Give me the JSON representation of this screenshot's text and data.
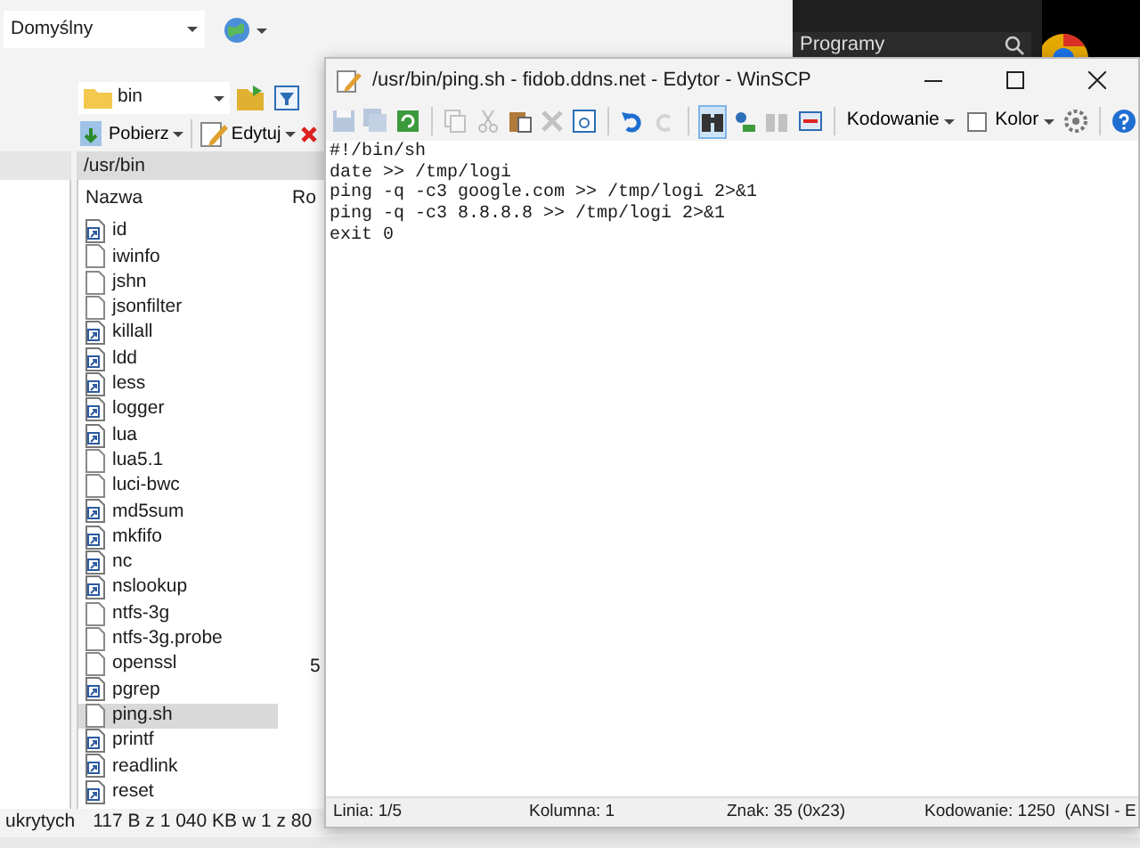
{
  "session": {
    "value": "Domyślny"
  },
  "desktop": {
    "start_search": "Programy"
  },
  "remote_panel": {
    "folder": "bin",
    "actions": [
      {
        "label": "Pobierz",
        "kind": "download"
      },
      {
        "label": "Edytuj",
        "kind": "edit"
      }
    ],
    "path": "/usr/bin",
    "columns": [
      "Nazwa",
      "Ro"
    ],
    "files": [
      {
        "name": "id",
        "kind": "link",
        "selected": false
      },
      {
        "name": "iwinfo",
        "kind": "file",
        "selected": false
      },
      {
        "name": "jshn",
        "kind": "file",
        "selected": false
      },
      {
        "name": "jsonfilter",
        "kind": "file",
        "selected": false
      },
      {
        "name": "killall",
        "kind": "link",
        "selected": false
      },
      {
        "name": "ldd",
        "kind": "link",
        "selected": false
      },
      {
        "name": "less",
        "kind": "link",
        "selected": false
      },
      {
        "name": "logger",
        "kind": "link",
        "selected": false
      },
      {
        "name": "lua",
        "kind": "link",
        "selected": false
      },
      {
        "name": "lua5.1",
        "kind": "file",
        "selected": false
      },
      {
        "name": "luci-bwc",
        "kind": "file",
        "selected": false
      },
      {
        "name": "md5sum",
        "kind": "link",
        "selected": false
      },
      {
        "name": "mkfifo",
        "kind": "link",
        "selected": false
      },
      {
        "name": "nc",
        "kind": "link",
        "selected": false
      },
      {
        "name": "nslookup",
        "kind": "link",
        "selected": false
      },
      {
        "name": "ntfs-3g",
        "kind": "file",
        "selected": false
      },
      {
        "name": "ntfs-3g.probe",
        "kind": "file",
        "selected": false
      },
      {
        "name": "openssl",
        "kind": "file",
        "selected": false,
        "size": "5"
      },
      {
        "name": "pgrep",
        "kind": "link",
        "selected": false
      },
      {
        "name": "ping.sh",
        "kind": "file",
        "selected": true
      },
      {
        "name": "printf",
        "kind": "link",
        "selected": false
      },
      {
        "name": "readlink",
        "kind": "link",
        "selected": false
      },
      {
        "name": "reset",
        "kind": "link",
        "selected": false
      }
    ],
    "status": [
      "ukrytych",
      "117 B z 1 040 KB w 1 z 80"
    ]
  },
  "editor": {
    "title": "/usr/bin/ping.sh - fidob.ddns.net - Edytor - WinSCP",
    "toolbar": [
      {
        "kind": "icon",
        "disabled": true,
        "selected": false
      },
      {
        "kind": "icon",
        "disabled": true,
        "selected": false
      },
      {
        "kind": "icon",
        "disabled": false,
        "selected": false
      },
      {
        "kind": "separator"
      },
      {
        "kind": "icon",
        "disabled": true,
        "selected": false
      },
      {
        "kind": "icon",
        "disabled": true,
        "selected": false
      },
      {
        "kind": "icon",
        "disabled": false,
        "selected": false
      },
      {
        "kind": "icon",
        "disabled": true,
        "selected": false
      },
      {
        "kind": "icon",
        "disabled": false,
        "selected": false
      },
      {
        "kind": "separator"
      },
      {
        "kind": "icon",
        "disabled": false,
        "selected": false
      },
      {
        "kind": "icon",
        "disabled": true,
        "selected": false
      },
      {
        "kind": "separator"
      },
      {
        "kind": "icon",
        "disabled": false,
        "selected": true
      },
      {
        "kind": "icon",
        "disabled": false,
        "selected": false
      },
      {
        "kind": "icon",
        "disabled": true,
        "selected": false
      },
      {
        "kind": "icon",
        "disabled": false,
        "selected": false
      },
      {
        "kind": "separator"
      },
      {
        "kind": "dropdown",
        "label": "Kodowanie"
      },
      {
        "kind": "checkbox",
        "label": "Kolor",
        "checked": false
      },
      {
        "kind": "icon",
        "disabled": false,
        "selected": false
      },
      {
        "kind": "separator"
      },
      {
        "kind": "icon",
        "disabled": false,
        "selected": false
      }
    ],
    "lines": [
      "#!/bin/sh",
      "date >> /tmp/logi",
      "ping -q -c3 google.com >> /tmp/logi 2>&1",
      "ping -q -c3 8.8.8.8 >> /tmp/logi 2>&1",
      "exit 0"
    ],
    "status": [
      "Linia: 1/5",
      "Kolumna: 1",
      "Znak: 35 (0x23)",
      "Kodowanie: 1250  (ANSI - E"
    ]
  }
}
